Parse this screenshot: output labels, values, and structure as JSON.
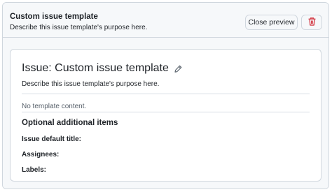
{
  "header": {
    "title": "Custom issue template",
    "description": "Describe this issue template's purpose here.",
    "close_preview_label": "Close preview",
    "delete_icon": "trash-icon"
  },
  "preview": {
    "title": "Issue: Custom issue template",
    "edit_icon": "pencil-icon",
    "description": "Describe this issue template's purpose here.",
    "no_content": "No template content.",
    "optional_heading": "Optional additional items",
    "fields": {
      "default_title": "Issue default title:",
      "assignees": "Assignees:",
      "labels": "Labels:"
    }
  },
  "colors": {
    "danger": "#cf222e",
    "border": "#d0d7de",
    "muted": "#57606a"
  }
}
